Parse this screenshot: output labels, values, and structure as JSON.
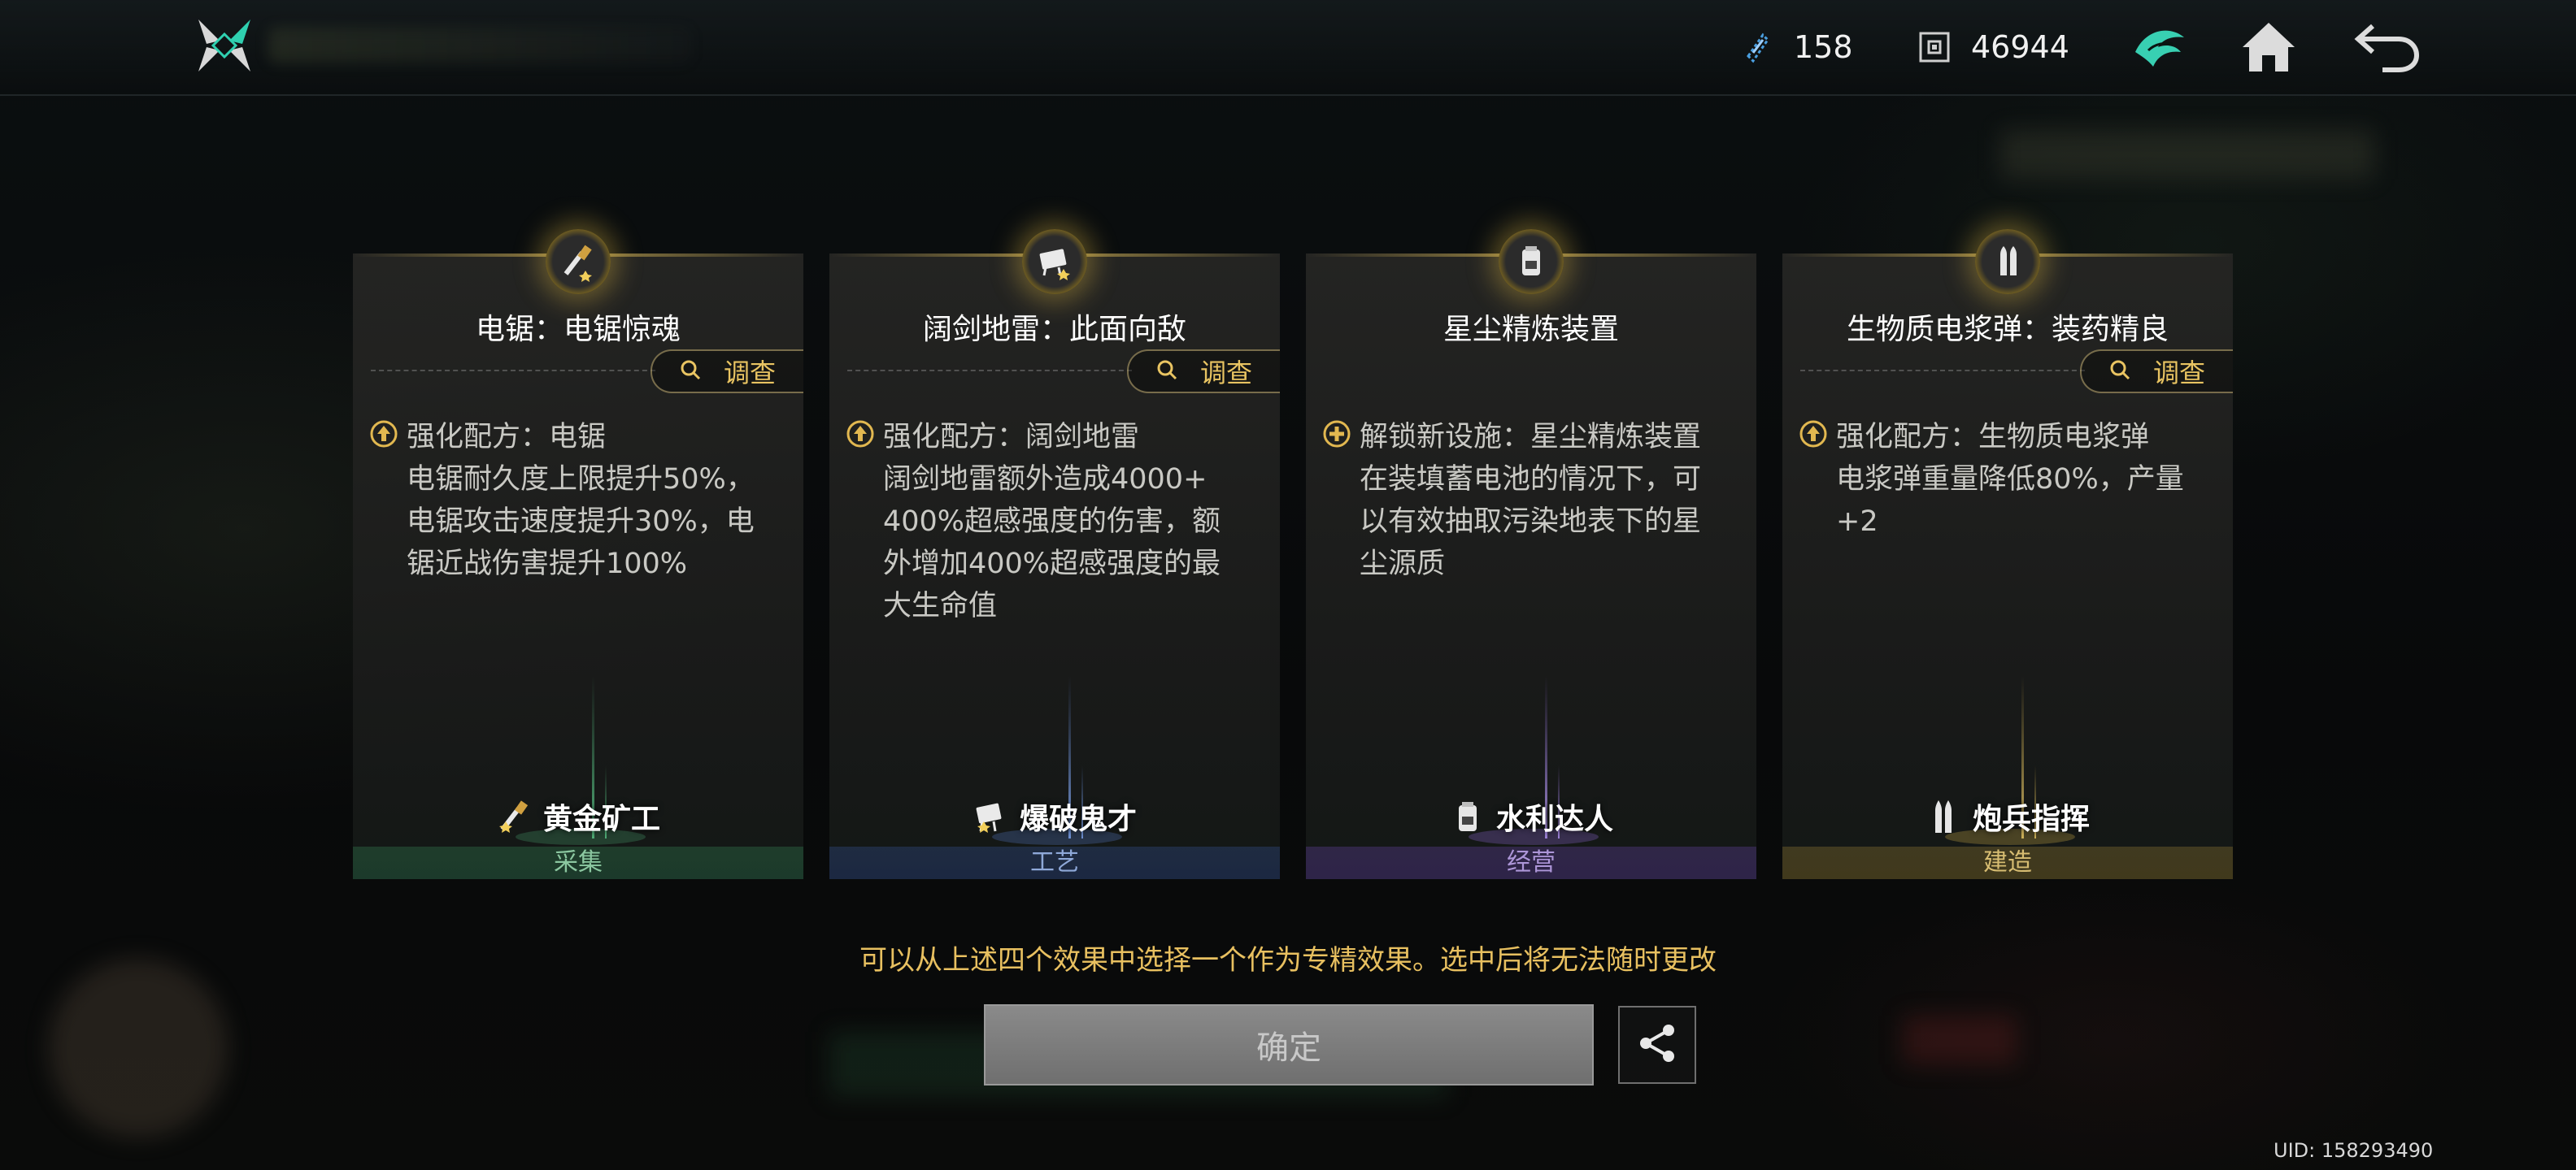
{
  "topbar": {
    "resource_1_value": "158",
    "resource_1_icon": "crystal-shard-icon",
    "resource_2_value": "46944",
    "resource_2_icon": "cube-currency-icon",
    "icons": [
      "logo-icon",
      "emblem-icon",
      "home-icon",
      "back-icon"
    ]
  },
  "cards": [
    {
      "title": "电锯：电锯惊魂",
      "investigate_label": "调查",
      "effect": "强化配方：电锯\n电锯耐久度上限提升50%，\n电锯攻击速度提升30%，电\n锯近战伤害提升100%",
      "effect_icon": "upgrade-icon",
      "role": "黄金矿工",
      "category": "采集",
      "accent": "#3f8a5e"
    },
    {
      "title": "阔剑地雷：此面向敌",
      "investigate_label": "调查",
      "effect": "强化配方：阔剑地雷\n阔剑地雷额外造成4000+\n400%超感强度的伤害，额\n外增加400%超感强度的最\n大生命值",
      "effect_icon": "upgrade-icon",
      "role": "爆破鬼才",
      "category": "工艺",
      "accent": "#4a69a8"
    },
    {
      "title": "星尘精炼装置",
      "investigate_label": "",
      "effect": "解锁新设施：星尘精炼装置\n在装填蓄电池的情况下，可\n以有效抽取污染地表下的星\n尘源质",
      "effect_icon": "unlock-plus-icon",
      "role": "水利达人",
      "category": "经营",
      "accent": "#7a5bb8"
    },
    {
      "title": "生物质电浆弹：装药精良",
      "investigate_label": "调查",
      "effect": "强化配方：生物质电浆弹\n电浆弹重量降低80%，产量\n+2",
      "effect_icon": "upgrade-icon",
      "role": "炮兵指挥",
      "category": "建造",
      "accent": "#b0943e"
    }
  ],
  "hint": "可以从上述四个效果中选择一个作为专精效果。选中后将无法随时更改",
  "confirm_label": "确定",
  "uid": "UID: 158293490",
  "colors": {
    "gold": "#e8c060",
    "investigate_gold": "#e9c462",
    "background": "#07090a"
  }
}
